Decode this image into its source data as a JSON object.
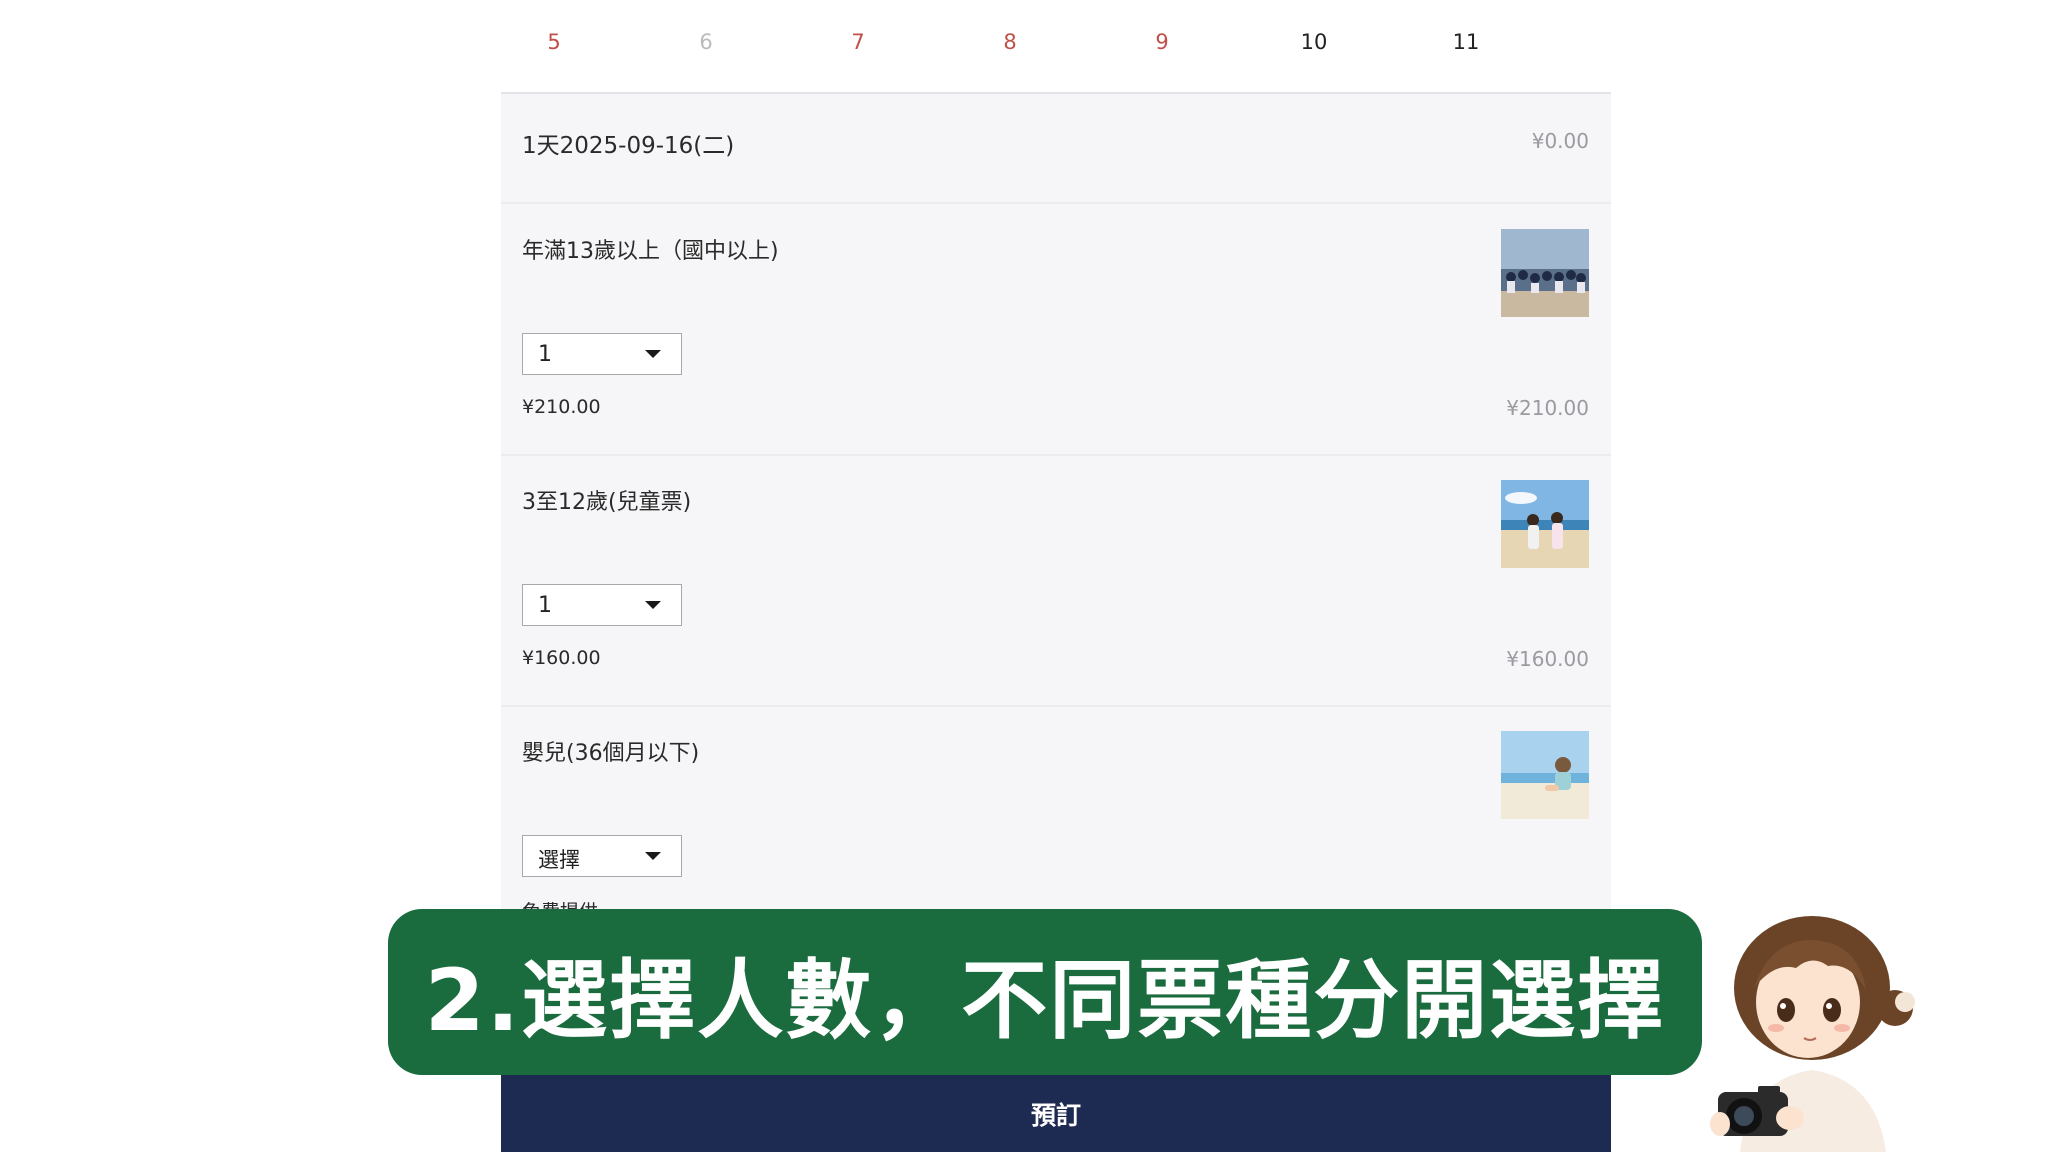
{
  "calendar": {
    "days": [
      {
        "label": "5",
        "style": "red"
      },
      {
        "label": "6",
        "style": "grey"
      },
      {
        "label": "7",
        "style": "red"
      },
      {
        "label": "8",
        "style": "red"
      },
      {
        "label": "9",
        "style": "red"
      },
      {
        "label": "10",
        "style": "normal"
      },
      {
        "label": "11",
        "style": "normal"
      }
    ]
  },
  "summary": {
    "date_text": "1天2025-09-16(二)",
    "total": "¥0.00"
  },
  "tickets": [
    {
      "name": "年滿13歲以上（國中以上)",
      "selected": "1",
      "unit_price": "¥210.00",
      "subtotal": "¥210.00",
      "thumbnail": "group-photo-thumbnail"
    },
    {
      "name": "3至12歲(兒童票)",
      "selected": "1",
      "unit_price": "¥160.00",
      "subtotal": "¥160.00",
      "thumbnail": "children-beach-thumbnail"
    },
    {
      "name": "嬰兒(36個月以下)",
      "selected": "選擇",
      "unit_price": "免費提供",
      "subtotal": "",
      "thumbnail": "toddler-beach-thumbnail"
    }
  ],
  "book_button": "預訂",
  "overlay": {
    "caption": "2.選擇人數，不同票種分開選擇",
    "banner_color": "#1a6b3e"
  },
  "colors": {
    "accent_red": "#c0504a",
    "book_button_bg": "#1d2a52"
  }
}
